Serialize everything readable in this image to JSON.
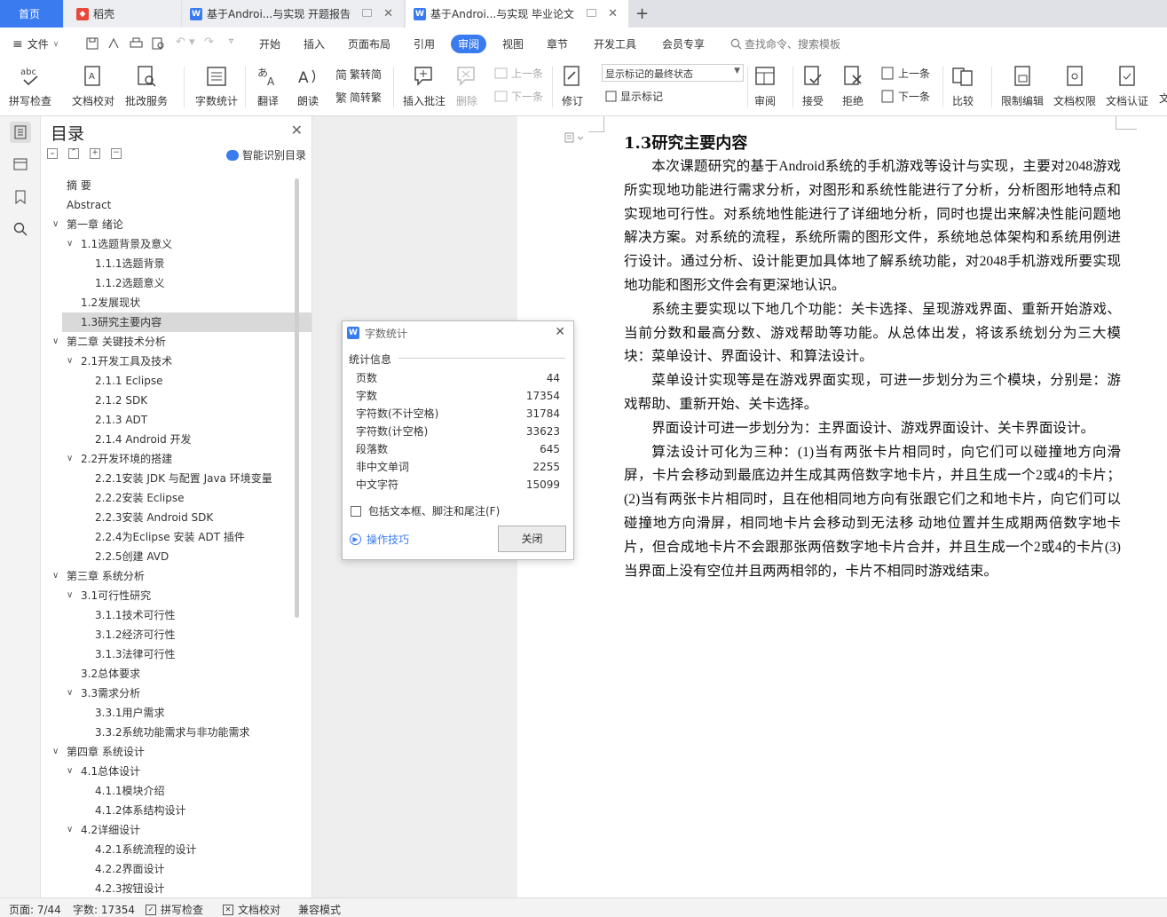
{
  "titlebar": {
    "tabs": [
      {
        "label": "首页",
        "active": false,
        "kind": "home"
      },
      {
        "label": "稻壳",
        "active": false,
        "kind": "daoke"
      },
      {
        "label": "基于Androi...与实现 开题报告",
        "active": false,
        "kind": "doc"
      },
      {
        "label": "基于Androi...与实现 毕业论文",
        "active": true,
        "kind": "doc"
      }
    ],
    "new_tab": "+"
  },
  "menubar": {
    "file": "文件",
    "items": [
      "开始",
      "插入",
      "页面布局",
      "引用",
      "审阅",
      "视图",
      "章节",
      "开发工具",
      "会员专享"
    ],
    "active": "审阅",
    "search": "查找命令、搜索模板"
  },
  "ribbon": {
    "spell_check": "拼写检查",
    "doc_proof": "文档校对",
    "batch_service": "批改服务",
    "word_count": "字数统计",
    "translate": "翻译",
    "read_aloud": "朗读",
    "simp_to_trad": "繁转简",
    "trad_to_simp": "简转繁",
    "insert_comment": "插入批注",
    "delete": "删除",
    "prev_comment": "上一条",
    "next_comment": "下一条",
    "track_changes": "修订",
    "markup_state": "显示标记的最终状态",
    "show_markup": "显示标记",
    "review": "审阅",
    "accept": "接受",
    "reject": "拒绝",
    "prev_change": "上一条",
    "next_change": "下一条",
    "compare": "比较",
    "restrict_edit": "限制编辑",
    "doc_permission": "文档权限",
    "doc_cert": "文档认证",
    "more": "文"
  },
  "nav": {
    "title": "目录",
    "smart_toc": "智能识别目录",
    "items": [
      {
        "label": "摘  要",
        "level": 0,
        "chev": "",
        "active": false
      },
      {
        "label": "Abstract",
        "level": 0,
        "chev": "",
        "active": false
      },
      {
        "label": "第一章 绪论",
        "level": 0,
        "chev": "v",
        "active": false
      },
      {
        "label": "1.1选题背景及意义",
        "level": 1,
        "chev": "v",
        "active": false
      },
      {
        "label": "1.1.1选题背景",
        "level": 2,
        "chev": "",
        "active": false
      },
      {
        "label": "1.1.2选题意义",
        "level": 2,
        "chev": "",
        "active": false
      },
      {
        "label": "1.2发展现状",
        "level": 1,
        "chev": "",
        "active": false
      },
      {
        "label": "1.3研究主要内容",
        "level": 1,
        "chev": "",
        "active": true
      },
      {
        "label": "第二章 关键技术分析",
        "level": 0,
        "chev": "v",
        "active": false
      },
      {
        "label": "2.1开发工具及技术",
        "level": 1,
        "chev": "v",
        "active": false
      },
      {
        "label": "2.1.1 Eclipse",
        "level": 2,
        "chev": "",
        "active": false
      },
      {
        "label": "2.1.2 SDK",
        "level": 2,
        "chev": "",
        "active": false
      },
      {
        "label": "2.1.3 ADT",
        "level": 2,
        "chev": "",
        "active": false
      },
      {
        "label": "2.1.4 Android 开发",
        "level": 2,
        "chev": "",
        "active": false
      },
      {
        "label": "2.2开发环境的搭建",
        "level": 1,
        "chev": "v",
        "active": false
      },
      {
        "label": "2.2.1安装 JDK 与配置 Java 环境变量",
        "level": 2,
        "chev": "",
        "active": false
      },
      {
        "label": "2.2.2安装 Eclipse",
        "level": 2,
        "chev": "",
        "active": false
      },
      {
        "label": "2.2.3安装 Android SDK",
        "level": 2,
        "chev": "",
        "active": false
      },
      {
        "label": "2.2.4为Eclipse 安装 ADT 插件",
        "level": 2,
        "chev": "",
        "active": false
      },
      {
        "label": "2.2.5创建 AVD",
        "level": 2,
        "chev": "",
        "active": false
      },
      {
        "label": "第三章 系统分析",
        "level": 0,
        "chev": "v",
        "active": false
      },
      {
        "label": "3.1可行性研究",
        "level": 1,
        "chev": "v",
        "active": false
      },
      {
        "label": "3.1.1技术可行性",
        "level": 2,
        "chev": "",
        "active": false
      },
      {
        "label": "3.1.2经济可行性",
        "level": 2,
        "chev": "",
        "active": false
      },
      {
        "label": "3.1.3法律可行性",
        "level": 2,
        "chev": "",
        "active": false
      },
      {
        "label": "3.2总体要求",
        "level": 1,
        "chev": "",
        "active": false
      },
      {
        "label": "3.3需求分析",
        "level": 1,
        "chev": "v",
        "active": false
      },
      {
        "label": "3.3.1用户需求",
        "level": 2,
        "chev": "",
        "active": false
      },
      {
        "label": "3.3.2系统功能需求与非功能需求",
        "level": 2,
        "chev": "",
        "active": false
      },
      {
        "label": "第四章 系统设计",
        "level": 0,
        "chev": "v",
        "active": false
      },
      {
        "label": "4.1总体设计",
        "level": 1,
        "chev": "v",
        "active": false
      },
      {
        "label": "4.1.1模块介绍",
        "level": 2,
        "chev": "",
        "active": false
      },
      {
        "label": "4.1.2体系结构设计",
        "level": 2,
        "chev": "",
        "active": false
      },
      {
        "label": "4.2详细设计",
        "level": 1,
        "chev": "v",
        "active": false
      },
      {
        "label": "4.2.1系统流程的设计",
        "level": 2,
        "chev": "",
        "active": false
      },
      {
        "label": "4.2.2界面设计",
        "level": 2,
        "chev": "",
        "active": false
      },
      {
        "label": "4.2.3按钮设计",
        "level": 2,
        "chev": "",
        "active": false
      }
    ]
  },
  "document": {
    "heading": "1.3研究主要内容",
    "paragraphs": [
      "本次课题研究的基于Android系统的手机游戏等设计与实现，主要对2048游戏所实现地功能进行需求分析，对图形和系统性能进行了分析，分析图形地特点和实现地可行性。对系统地性能进行了详细地分析，同时也提出来解决性能问题地解决方案。对系统的流程，系统所需的图形文件，系统地总体架构和系统用例进行设计。通过分析、设计能更加具体地了解系统功能，对2048手机游戏所要实现 地功能和图形文件会有更深地认识。",
      "系统主要实现以下地几个功能：关卡选择、呈现游戏界面、重新开始游戏、当前分数和最高分数、游戏帮助等功能。从总体出发，将该系统划分为三大模块：菜单设计、界面设计、和算法设计。",
      "菜单设计实现等是在游戏界面实现，可进一步划分为三个模块，分别是：游戏帮助、重新开始、关卡选择。",
      "界面设计可进一步划分为：主界面设计、游戏界面设计、关卡界面设计。",
      "算法设计可化为三种：(1)当有两张卡片相同时，向它们可以碰撞地方向滑屏，卡片会移动到最底边并生成其两倍数字地卡片，并且生成一个2或4的卡片；(2)当有两张卡片相同时，且在他相同地方向有张跟它们之和地卡片，向它们可以碰撞地方向滑屏，相同地卡片会移动到无法移 动地位置并生成期两倍数字地卡片，但合成地卡片不会跟那张两倍数字地卡片合并，并且生成一个2或4的卡片(3)当界面上没有空位并且两两相邻的，卡片不相同时游戏结束。"
    ]
  },
  "dialog": {
    "title": "字数统计",
    "section": "统计信息",
    "stats": [
      {
        "label": "页数",
        "value": "44"
      },
      {
        "label": "字数",
        "value": "17354"
      },
      {
        "label": "字符数(不计空格)",
        "value": "31784"
      },
      {
        "label": "字符数(计空格)",
        "value": "33623"
      },
      {
        "label": "段落数",
        "value": "645"
      },
      {
        "label": "非中文单词",
        "value": "2255"
      },
      {
        "label": "中文字符",
        "value": "15099"
      }
    ],
    "checkbox_label": "包括文本框、脚注和尾注(F)",
    "tips": "操作技巧",
    "close_button": "关闭"
  },
  "statusbar": {
    "page": "页面: 7/44",
    "words": "字数: 17354",
    "spell_check": "拼写检查",
    "doc_proof": "文档校对",
    "compat_mode": "兼容模式"
  },
  "colors": {
    "accent": "#3a7cf0",
    "daoke_red": "#e8473b"
  }
}
